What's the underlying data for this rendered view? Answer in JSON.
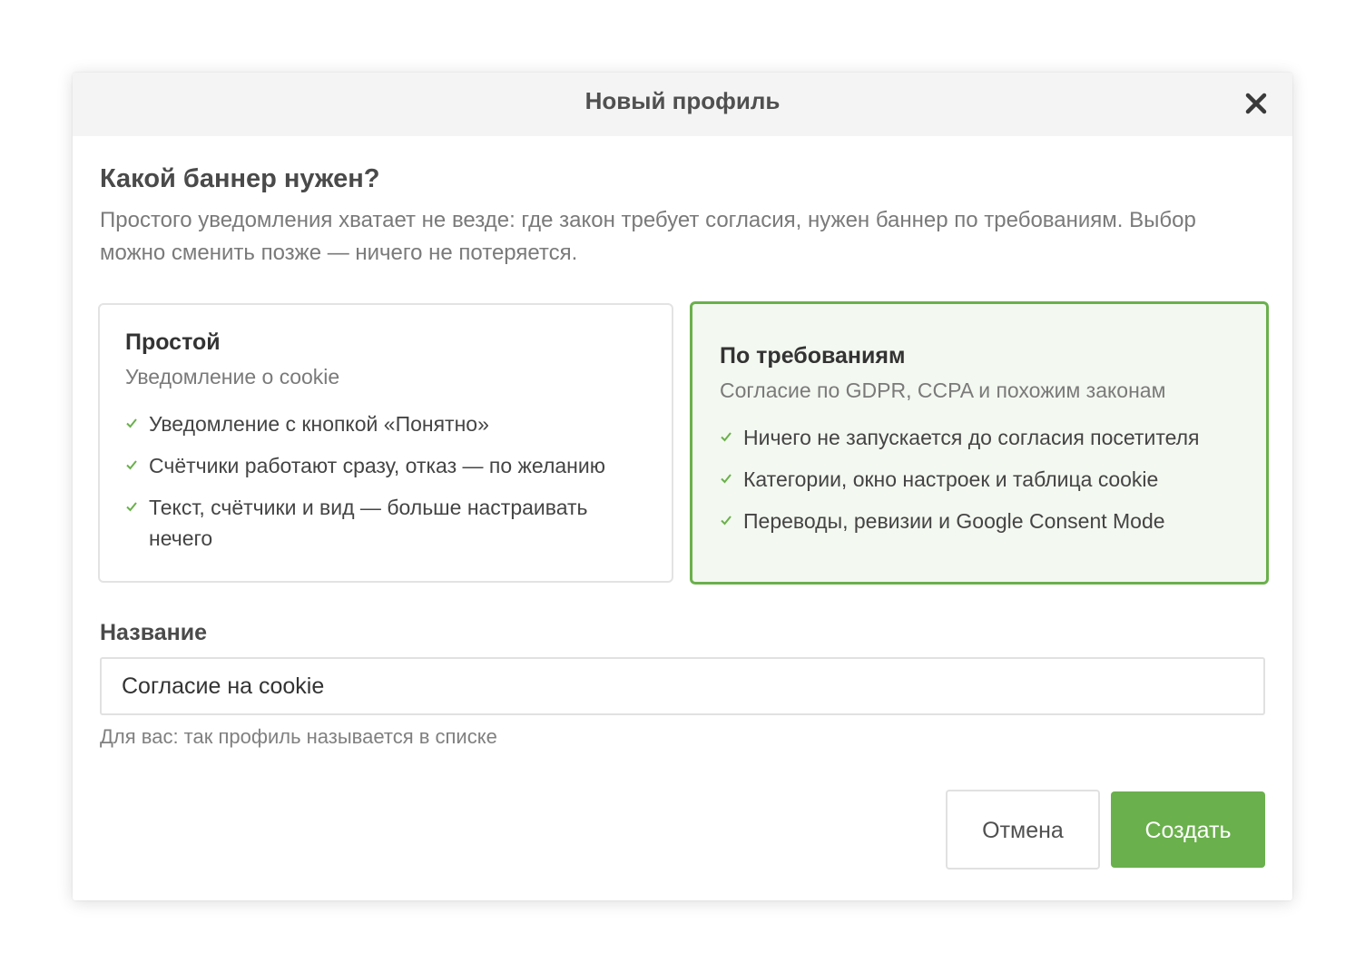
{
  "dialog": {
    "title": "Новый профиль",
    "close_icon": "close-icon"
  },
  "question": {
    "title": "Какой баннер нужен?",
    "description": "Простого уведомления хватает не везде: где закон требует согласия, нужен баннер по требованиям. Выбор можно сменить позже — ничего не потеряется."
  },
  "options": [
    {
      "title": "Простой",
      "subtitle": "Уведомление о cookie",
      "selected": false,
      "features": [
        "Уведомление с кнопкой «Понятно»",
        "Счётчики работают сразу, отказ — по желанию",
        "Текст, счётчики и вид — больше настраивать нечего"
      ]
    },
    {
      "title": "По требованиям",
      "subtitle": "Согласие по GDPR, CCPA и похожим законам",
      "selected": true,
      "features": [
        "Ничего не запускается до согласия посетителя",
        "Категории, окно настроек и таблица cookie",
        "Переводы, ревизии и Google Consent Mode"
      ]
    }
  ],
  "name_field": {
    "label": "Название",
    "value": "Согласие на cookie",
    "hint": "Для вас: так профиль называется в списке"
  },
  "actions": {
    "cancel_label": "Отмена",
    "create_label": "Создать"
  },
  "colors": {
    "accent": "#6ab04c",
    "selected_bg": "#f3f8f0",
    "header_bg": "#f4f4f4"
  }
}
